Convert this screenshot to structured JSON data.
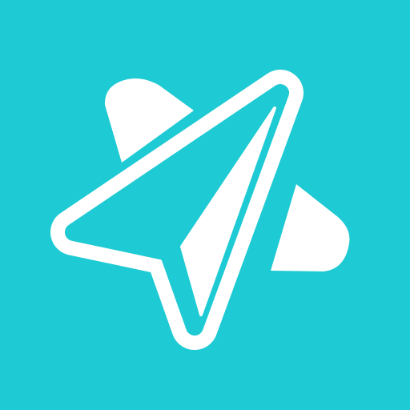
{
  "icon": {
    "name": "paper-plane-star-logo",
    "colors": {
      "background": "#1ECAD3",
      "foreground": "#FFFFFF"
    }
  }
}
